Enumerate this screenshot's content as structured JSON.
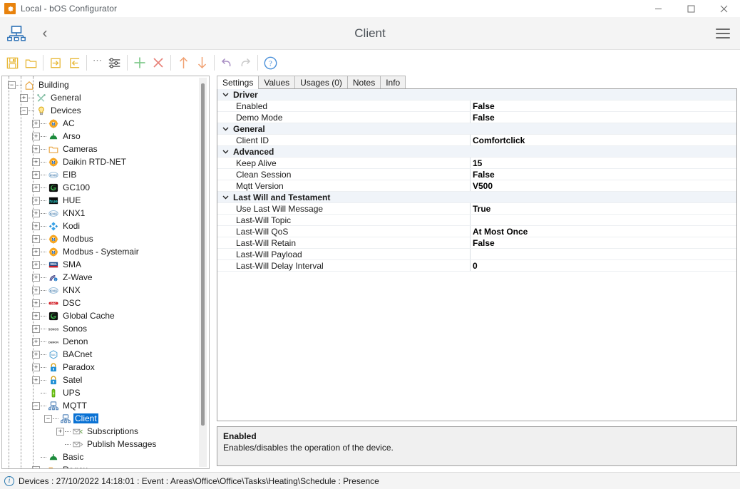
{
  "window": {
    "title": "Local - bOS Configurator",
    "app_icon": "gear-icon",
    "minimize_label": "Minimize",
    "maximize_label": "Maximize",
    "close_label": "Close"
  },
  "header": {
    "title": "Client",
    "sitemap_icon": "sitemap-icon",
    "back_icon": "back-chevron-icon",
    "menu_icon": "hamburger-menu-icon"
  },
  "toolbar": {
    "buttons": [
      {
        "name": "save-icon",
        "label": "Save"
      },
      {
        "name": "open-folder-icon",
        "label": "Open"
      },
      {
        "name": "export-icon",
        "label": "Export"
      },
      {
        "name": "import-icon",
        "label": "Import"
      },
      {
        "name": "more-options-icon",
        "label": "..."
      },
      {
        "name": "settings-sliders-icon",
        "label": "Settings"
      },
      {
        "name": "add-icon",
        "label": "Add"
      },
      {
        "name": "delete-icon",
        "label": "Delete"
      },
      {
        "name": "move-up-icon",
        "label": "Move Up"
      },
      {
        "name": "move-down-icon",
        "label": "Move Down"
      },
      {
        "name": "undo-icon",
        "label": "Undo"
      },
      {
        "name": "redo-icon",
        "label": "Redo"
      },
      {
        "name": "help-icon",
        "label": "Help"
      }
    ]
  },
  "tree": {
    "items": [
      {
        "label": "Building",
        "depth": 0,
        "expander": "minus",
        "icon": "house-icon",
        "selected": false
      },
      {
        "label": "General",
        "depth": 1,
        "expander": "plus",
        "icon": "tools-icon",
        "selected": false
      },
      {
        "label": "Devices",
        "depth": 1,
        "expander": "minus",
        "icon": "bulb-icon",
        "selected": false
      },
      {
        "label": "AC",
        "depth": 2,
        "expander": "plus",
        "icon": "gear-orange-icon",
        "selected": false
      },
      {
        "label": "Arso",
        "depth": 2,
        "expander": "plus",
        "icon": "cloud-green-icon",
        "selected": false
      },
      {
        "label": "Cameras",
        "depth": 2,
        "expander": "plus",
        "icon": "folder-icon",
        "selected": false
      },
      {
        "label": "Daikin RTD-NET",
        "depth": 2,
        "expander": "plus",
        "icon": "gear-orange-icon",
        "selected": false
      },
      {
        "label": "EIB",
        "depth": 2,
        "expander": "plus",
        "icon": "knx-icon",
        "selected": false
      },
      {
        "label": "GC100",
        "depth": 2,
        "expander": "plus",
        "icon": "globalcache-icon",
        "selected": false
      },
      {
        "label": "HUE",
        "depth": 2,
        "expander": "plus",
        "icon": "hue-icon",
        "selected": false
      },
      {
        "label": "KNX1",
        "depth": 2,
        "expander": "plus",
        "icon": "knx-icon",
        "selected": false
      },
      {
        "label": "Kodi",
        "depth": 2,
        "expander": "plus",
        "icon": "kodi-icon",
        "selected": false
      },
      {
        "label": "Modbus",
        "depth": 2,
        "expander": "plus",
        "icon": "gear-orange-icon",
        "selected": false
      },
      {
        "label": "Modbus - Systemair",
        "depth": 2,
        "expander": "plus",
        "icon": "gear-orange-icon",
        "selected": false
      },
      {
        "label": "SMA",
        "depth": 2,
        "expander": "plus",
        "icon": "sma-icon",
        "selected": false
      },
      {
        "label": "Z-Wave",
        "depth": 2,
        "expander": "plus",
        "icon": "zwave-icon",
        "selected": false
      },
      {
        "label": "KNX",
        "depth": 2,
        "expander": "plus",
        "icon": "knx-icon",
        "selected": false
      },
      {
        "label": "DSC",
        "depth": 2,
        "expander": "plus",
        "icon": "dsc-icon",
        "selected": false
      },
      {
        "label": "Global Cache",
        "depth": 2,
        "expander": "plus",
        "icon": "globalcache-icon",
        "selected": false
      },
      {
        "label": "Sonos",
        "depth": 2,
        "expander": "plus",
        "icon": "sonos-icon",
        "selected": false
      },
      {
        "label": "Denon",
        "depth": 2,
        "expander": "plus",
        "icon": "denon-icon",
        "selected": false
      },
      {
        "label": "BACnet",
        "depth": 2,
        "expander": "plus",
        "icon": "bacnet-icon",
        "selected": false
      },
      {
        "label": "Paradox",
        "depth": 2,
        "expander": "plus",
        "icon": "lock-icon",
        "selected": false
      },
      {
        "label": "Satel",
        "depth": 2,
        "expander": "plus",
        "icon": "lock-icon",
        "selected": false
      },
      {
        "label": "UPS",
        "depth": 2,
        "expander": "none",
        "icon": "battery-icon",
        "selected": false
      },
      {
        "label": "MQTT",
        "depth": 2,
        "expander": "minus",
        "icon": "network-icon",
        "selected": false
      },
      {
        "label": "Client",
        "depth": 3,
        "expander": "minus",
        "icon": "network-icon",
        "selected": true
      },
      {
        "label": "Subscriptions",
        "depth": 4,
        "expander": "plus",
        "icon": "envelope-in-icon",
        "selected": false
      },
      {
        "label": "Publish Messages",
        "depth": 4,
        "expander": "none",
        "icon": "envelope-out-icon",
        "selected": false
      },
      {
        "label": "Basic",
        "depth": 2,
        "expander": "none",
        "icon": "cloud-green-icon",
        "selected": false
      },
      {
        "label": "Regex",
        "depth": 2,
        "expander": "plus",
        "icon": "folder-icon",
        "selected": false
      }
    ]
  },
  "tabs": [
    {
      "label": "Settings",
      "active": true
    },
    {
      "label": "Values",
      "active": false
    },
    {
      "label": "Usages (0)",
      "active": false
    },
    {
      "label": "Notes",
      "active": false
    },
    {
      "label": "Info",
      "active": false
    }
  ],
  "properties": [
    {
      "type": "group",
      "name": "Driver",
      "value": ""
    },
    {
      "type": "item",
      "name": "Enabled",
      "value": "False"
    },
    {
      "type": "item",
      "name": "Demo Mode",
      "value": "False"
    },
    {
      "type": "group",
      "name": "General",
      "value": ""
    },
    {
      "type": "item",
      "name": "Client ID",
      "value": "Comfortclick"
    },
    {
      "type": "group",
      "name": "Advanced",
      "value": ""
    },
    {
      "type": "item",
      "name": "Keep Alive",
      "value": "15"
    },
    {
      "type": "item",
      "name": "Clean Session",
      "value": "False"
    },
    {
      "type": "item",
      "name": "Mqtt Version",
      "value": "V500"
    },
    {
      "type": "group",
      "name": "Last Will and Testament",
      "value": ""
    },
    {
      "type": "item",
      "name": "Use Last Will Message",
      "value": "True"
    },
    {
      "type": "item",
      "name": "Last-Will Topic",
      "value": ""
    },
    {
      "type": "item",
      "name": "Last-Will QoS",
      "value": "At Most Once"
    },
    {
      "type": "item",
      "name": "Last-Will Retain",
      "value": "False"
    },
    {
      "type": "item",
      "name": "Last-Will Payload",
      "value": ""
    },
    {
      "type": "item",
      "name": "Last-Will Delay Interval",
      "value": "0"
    }
  ],
  "description": {
    "title": "Enabled",
    "text": "Enables/disables the operation of the device."
  },
  "statusbar": {
    "icon": "info-icon",
    "text": "Devices : 27/10/2022 14:18:01 : Event : Areas\\Office\\Office\\Tasks\\Heating\\Schedule : Presence"
  },
  "colors": {
    "selection": "#0a72d4",
    "accent_orange": "#e8820c",
    "header_bg": "#f4f4f4",
    "group_row_bg": "#f0f4f9"
  }
}
